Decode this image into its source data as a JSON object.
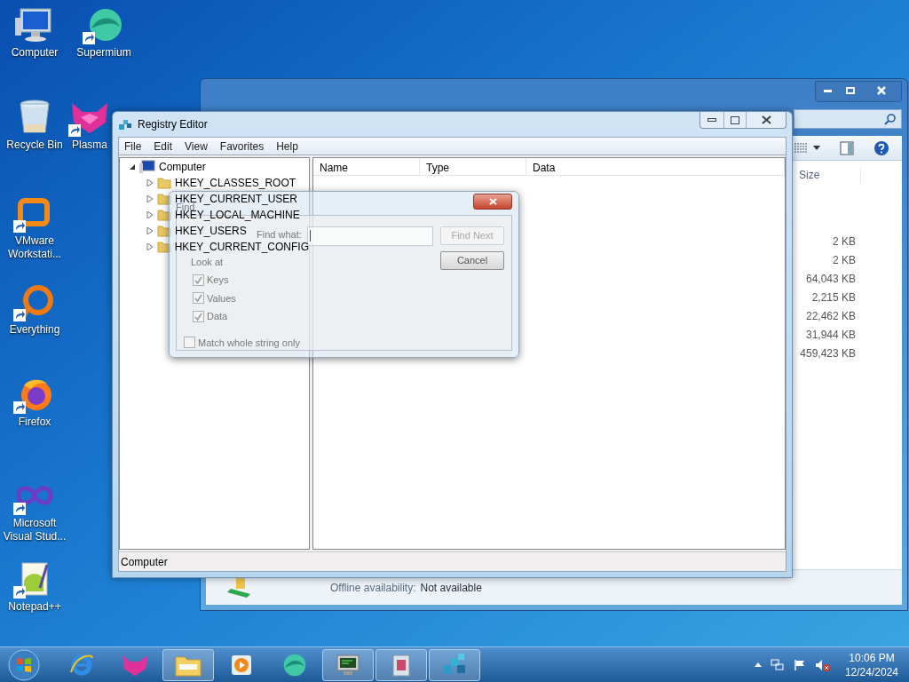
{
  "desktop_icons": [
    {
      "label": "Computer",
      "kind": "computer",
      "shortcut": false
    },
    {
      "label": "Supermium",
      "kind": "supermium",
      "shortcut": true
    },
    {
      "label": "Recycle Bin",
      "kind": "recycle",
      "shortcut": false
    },
    {
      "label": "Plasma",
      "kind": "plasma",
      "shortcut": true
    },
    {
      "label": "VMware Workstati...",
      "kind": "vmware",
      "shortcut": true
    },
    {
      "label": "Everything",
      "kind": "everything",
      "shortcut": true
    },
    {
      "label": "Firefox",
      "kind": "firefox",
      "shortcut": true
    },
    {
      "label": "Microsoft Visual Stud...",
      "kind": "vs",
      "shortcut": true
    },
    {
      "label": "Notepad++",
      "kind": "notepad",
      "shortcut": true
    }
  ],
  "explorer_window": {
    "size_header": "Size",
    "sizes": [
      "2 KB",
      "2 KB",
      "64,043 KB",
      "2,215 KB",
      "22,462 KB",
      "31,944 KB",
      "459,423 KB"
    ],
    "details": {
      "label": "Offline availability:",
      "value": "Not available"
    }
  },
  "registry_editor": {
    "title": "Registry Editor",
    "menu": [
      "File",
      "Edit",
      "View",
      "Favorites",
      "Help"
    ],
    "tree": [
      {
        "label": "Computer",
        "expanded": true,
        "children": [
          {
            "label": "HKEY_CLASSES_ROOT",
            "expanded": false
          },
          {
            "label": "HKEY_CURRENT_USER",
            "expanded": false
          },
          {
            "label": "HKEY_LOCAL_MACHINE",
            "expanded": false
          },
          {
            "label": "HKEY_USERS",
            "expanded": false
          },
          {
            "label": "HKEY_CURRENT_CONFIG",
            "expanded": false
          }
        ]
      }
    ],
    "columns": [
      "Name",
      "Type",
      "Data"
    ],
    "status_bar": "Computer"
  },
  "find_dialog": {
    "title": "Find",
    "find_what_label": "Find what:",
    "look_at_label": "Look at",
    "buttons": [
      {
        "label": "Find Next",
        "disabled": true
      },
      {
        "label": "Cancel",
        "disabled": false
      }
    ],
    "options": [
      {
        "label": "Keys",
        "checked": true
      },
      {
        "label": "Values",
        "checked": true
      },
      {
        "label": "Data",
        "checked": true
      }
    ],
    "match_whole": {
      "label": "Match whole string only",
      "checked": false
    }
  },
  "taskbar": {
    "items": [
      {
        "kind": "ie",
        "running": false
      },
      {
        "kind": "plasma",
        "running": false
      },
      {
        "kind": "folder",
        "running": true
      },
      {
        "kind": "media",
        "running": false
      },
      {
        "kind": "supermium",
        "running": false
      },
      {
        "kind": "monitor",
        "running": true
      },
      {
        "kind": "installer",
        "running": true
      },
      {
        "kind": "regedit",
        "running": true
      }
    ],
    "time": "10:06 PM",
    "date": "12/24/2024"
  }
}
